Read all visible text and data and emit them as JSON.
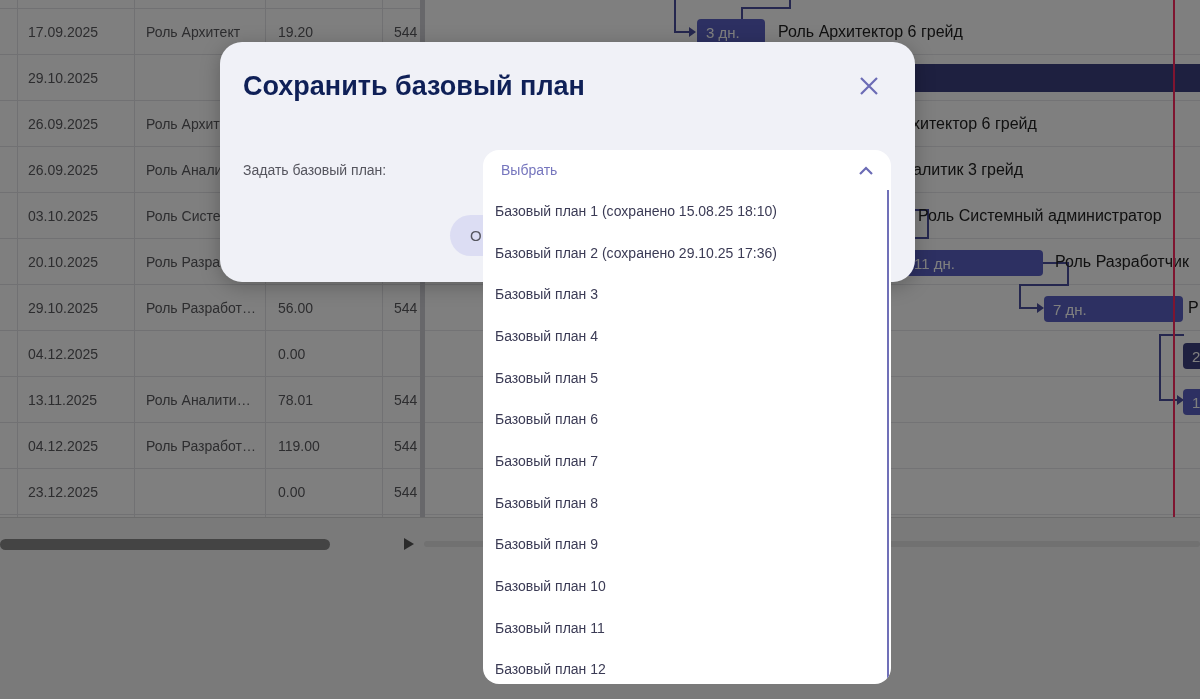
{
  "table": {
    "rows": [
      {
        "cells": [
          "17.09.2025",
          "Роль Архитект",
          "19.20",
          "544"
        ]
      },
      {
        "cells": [
          "29.10.2025",
          "",
          "",
          ""
        ]
      },
      {
        "cells": [
          "26.09.2025",
          "Роль Архит",
          "",
          ""
        ]
      },
      {
        "cells": [
          "26.09.2025",
          "Роль Анали",
          "",
          ""
        ]
      },
      {
        "cells": [
          "03.10.2025",
          "Роль Систе",
          "",
          ""
        ]
      },
      {
        "cells": [
          "20.10.2025",
          "Роль Разра",
          "",
          ""
        ]
      },
      {
        "cells": [
          "29.10.2025",
          "Роль Разработ…",
          "56.00",
          "544"
        ]
      },
      {
        "cells": [
          "04.12.2025",
          "",
          "0.00",
          ""
        ]
      },
      {
        "cells": [
          "13.11.2025",
          "Роль Аналити…",
          "78.01",
          "544"
        ]
      },
      {
        "cells": [
          "04.12.2025",
          "Роль Разработ…",
          "119.00",
          "544"
        ]
      },
      {
        "cells": [
          "23.12.2025",
          "",
          "0.00",
          "544"
        ]
      }
    ]
  },
  "gantt": {
    "items": [
      {
        "kind": "task",
        "text": "3 дн."
      },
      {
        "kind": "label",
        "text": "Роль Архитектор 6 грейд"
      },
      {
        "kind": "summary"
      },
      {
        "kind": "label",
        "text": "хитектор 6 грейд"
      },
      {
        "kind": "label",
        "text": "алитик 3 грейд"
      },
      {
        "kind": "label",
        "text": "Роль Системный администратор"
      },
      {
        "kind": "task",
        "text": "11 дн."
      },
      {
        "kind": "label",
        "text": "Роль Разработчик"
      },
      {
        "kind": "task",
        "text": "7 дн."
      },
      {
        "kind": "label",
        "text": "Р"
      },
      {
        "kind": "summary",
        "text": "2"
      },
      {
        "kind": "task",
        "text": "1"
      }
    ]
  },
  "dialog": {
    "title": "Сохранить базовый план",
    "field": {
      "label": "Задать базовый план:",
      "placeholder": "Выбрать",
      "expanded": true,
      "options": [
        {
          "label": "Базовый план 1 (сохранено 15.08.25 18:10)",
          "selected": false
        },
        {
          "label": "Базовый план 2 (сохранено 29.10.25 17:36)",
          "selected": false
        },
        {
          "label": "Базовый план 3",
          "selected": false
        },
        {
          "label": "Базовый план 4",
          "selected": false
        },
        {
          "label": "Базовый план 5",
          "selected": false
        },
        {
          "label": "Базовый план 6",
          "selected": false
        },
        {
          "label": "Базовый план 7",
          "selected": false
        },
        {
          "label": "Базовый план 8",
          "selected": false
        },
        {
          "label": "Базовый план 9",
          "selected": false
        },
        {
          "label": "Базовый план 10",
          "selected": false
        },
        {
          "label": "Базовый план 11",
          "selected": false
        },
        {
          "label": "Базовый план 12",
          "selected": false
        }
      ]
    },
    "buttons": [
      "О"
    ]
  }
}
